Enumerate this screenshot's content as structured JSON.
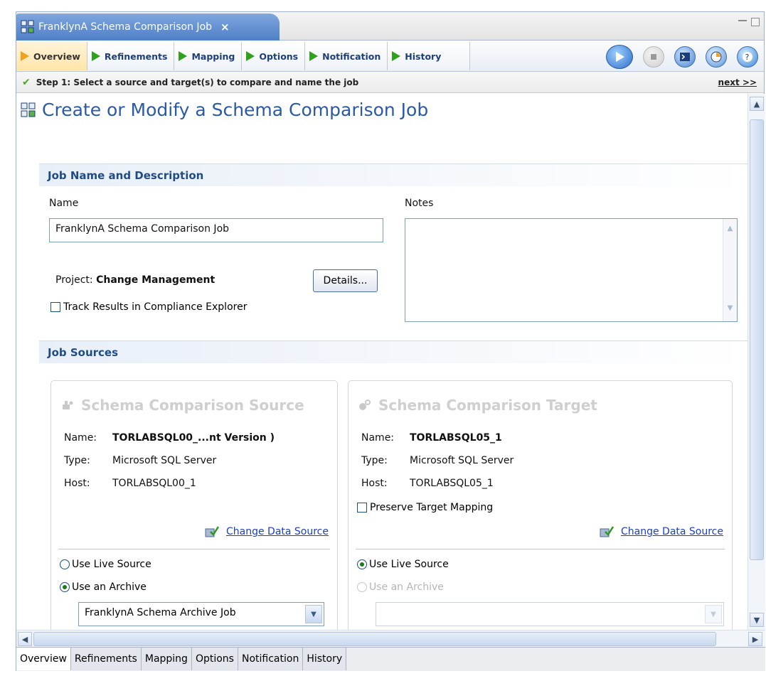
{
  "window": {
    "doc_tab_title": "FranklynA Schema Comparison Job",
    "close_glyph": "×"
  },
  "section_tabs": [
    {
      "label": "Overview",
      "active": true
    },
    {
      "label": "Refinements",
      "active": false
    },
    {
      "label": "Mapping",
      "active": false
    },
    {
      "label": "Options",
      "active": false
    },
    {
      "label": "Notification",
      "active": false
    },
    {
      "label": "History",
      "active": false
    }
  ],
  "toolbar_icons": [
    "run-icon",
    "stop-icon",
    "console-icon",
    "schedule-icon",
    "help-icon"
  ],
  "step": {
    "text": "Step 1: Select a source and target(s) to compare and name the job",
    "next_link": "next >>"
  },
  "page": {
    "title": "Create or Modify a Schema Comparison Job"
  },
  "job_name_section": {
    "header": "Job Name and Description",
    "name_label": "Name",
    "name_value": "FranklynA Schema Comparison Job",
    "notes_label": "Notes",
    "notes_value": "",
    "project_label": "Project:",
    "project_value": "Change Management",
    "details_button": "Details...",
    "track_checkbox_label": "Track Results in Compliance Explorer",
    "track_checked": false
  },
  "job_sources_section": {
    "header": "Job Sources",
    "source": {
      "title": "Schema Comparison Source",
      "name_key": "Name:",
      "name_value": "TORLABSQL00_...nt Version )",
      "type_key": "Type:",
      "type_value": "Microsoft SQL Server",
      "host_key": "Host:",
      "host_value": "TORLABSQL00_1",
      "change_link": "Change Data Source",
      "use_live_label": "Use Live Source",
      "use_archive_label": "Use an Archive",
      "selected_option": "archive",
      "archive_select_value": "FranklynA Schema Archive Job"
    },
    "target": {
      "title": "Schema Comparison Target",
      "name_key": "Name:",
      "name_value": "TORLABSQL05_1",
      "type_key": "Type:",
      "type_value": "Microsoft SQL Server",
      "host_key": "Host:",
      "host_value": "TORLABSQL05_1",
      "preserve_label": "Preserve Target Mapping",
      "preserve_checked": false,
      "change_link": "Change Data Source",
      "use_live_label": "Use Live Source",
      "use_archive_label": "Use an Archive",
      "selected_option": "live",
      "archive_select_value": ""
    }
  },
  "bottom_tabs": [
    {
      "label": "Overview",
      "active": true
    },
    {
      "label": "Refinements",
      "active": false
    },
    {
      "label": "Mapping",
      "active": false
    },
    {
      "label": "Options",
      "active": false
    },
    {
      "label": "Notification",
      "active": false
    },
    {
      "label": "History",
      "active": false
    }
  ],
  "colors": {
    "accent_blue": "#2a5aa5",
    "section_header_text": "#1f4c86",
    "tab_arrow_green": "#2fa11b",
    "active_tab_orange": "#f0a21e",
    "link_blue": "#1a3fbf"
  }
}
